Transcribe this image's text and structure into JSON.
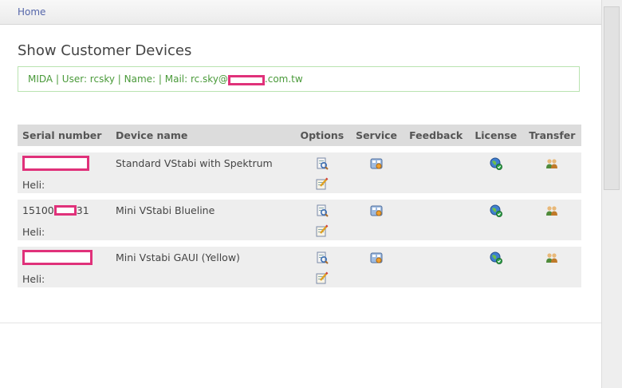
{
  "breadcrumb": {
    "home": "Home"
  },
  "page": {
    "title": "Show Customer Devices",
    "info_prefix": "MIDA | User: rcsky | Name: | Mail: rc.sky@",
    "info_suffix": ".com.tw"
  },
  "table": {
    "headers": {
      "serial": "Serial number",
      "device": "Device name",
      "options": "Options",
      "service": "Service",
      "feedback": "Feedback",
      "license": "License",
      "transfer": "Transfer"
    },
    "rows": [
      {
        "serial_start": "",
        "serial_end": "",
        "device": "Standard VStabi with Spektrum",
        "heli": "Heli:"
      },
      {
        "serial_start": "15100",
        "serial_end": "31",
        "device": "Mini VStabi Blueline",
        "heli": "Heli:"
      },
      {
        "serial_start": "",
        "serial_end": "",
        "device": "Mini Vstabi GAUI (Yellow)",
        "heli": "Heli:"
      }
    ]
  },
  "colors": {
    "link": "#5566aa",
    "info_text": "#4a9a3a",
    "info_border": "#b9e3b0",
    "redaction": "#e0317a"
  },
  "icons": [
    "edit-device-icon",
    "notes-icon",
    "service-icon",
    "license-globe-icon",
    "transfer-users-icon"
  ]
}
